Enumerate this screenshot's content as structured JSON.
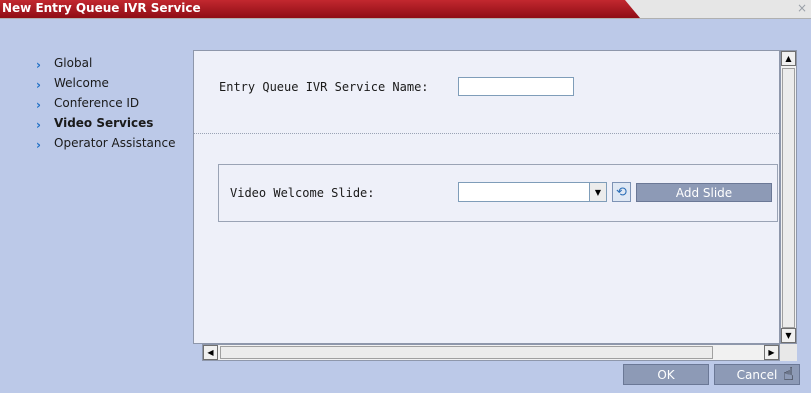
{
  "window": {
    "title": "New Entry Queue IVR Service",
    "close_glyph": "×"
  },
  "nav": {
    "items": [
      {
        "label": "Global",
        "active": false
      },
      {
        "label": "Welcome",
        "active": false
      },
      {
        "label": "Conference ID",
        "active": false
      },
      {
        "label": "Video Services",
        "active": true
      },
      {
        "label": "Operator Assistance",
        "active": false
      }
    ]
  },
  "form": {
    "service_name_label": "Entry Queue IVR Service Name:",
    "service_name_value": "",
    "video_slide_label": "Video Welcome Slide:",
    "video_slide_value": "",
    "add_slide_label": "Add Slide"
  },
  "footer": {
    "ok_label": "OK",
    "cancel_label": "Cancel"
  },
  "colors": {
    "title_bar": "#b01c23",
    "dialog_bg": "#bcc9e8",
    "button_bg": "#8d9ab6"
  },
  "icons": [
    "chevron-right-icon",
    "preview-slide-icon",
    "scroll-up-icon",
    "scroll-down-icon",
    "scroll-left-icon",
    "scroll-right-icon",
    "dropdown-arrow-icon",
    "close-icon",
    "hand-cursor-icon"
  ]
}
